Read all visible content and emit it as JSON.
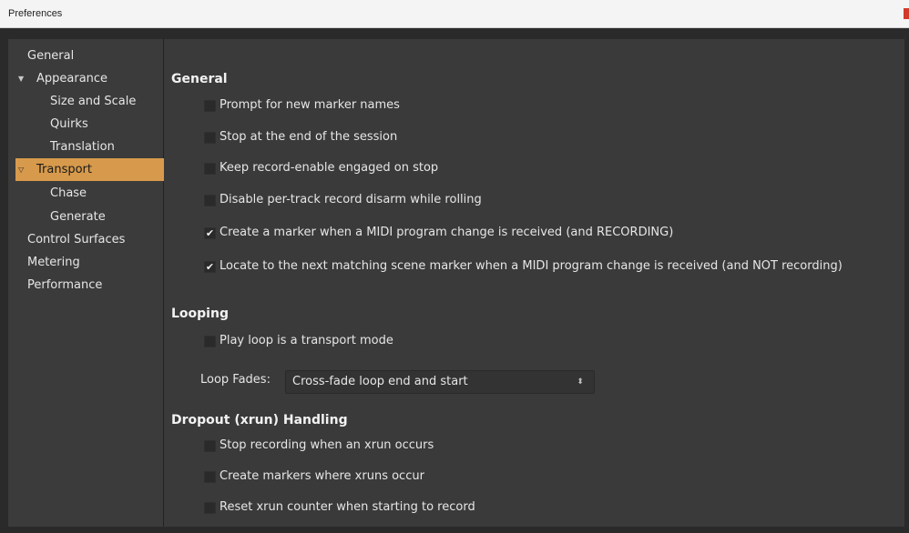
{
  "window": {
    "title": "Preferences"
  },
  "sidebar": {
    "items": [
      {
        "label": "General",
        "indent": 0,
        "arrow": "",
        "selected": false
      },
      {
        "label": "Appearance",
        "indent": 1,
        "arrow": "▼",
        "selected": false
      },
      {
        "label": "Size and Scale",
        "indent": 2,
        "arrow": "",
        "selected": false
      },
      {
        "label": "Quirks",
        "indent": 2,
        "arrow": "",
        "selected": false
      },
      {
        "label": "Translation",
        "indent": 2,
        "arrow": "",
        "selected": false
      },
      {
        "label": "Transport",
        "indent": 1,
        "arrow": "▽",
        "selected": true
      },
      {
        "label": "Chase",
        "indent": 2,
        "arrow": "",
        "selected": false
      },
      {
        "label": "Generate",
        "indent": 2,
        "arrow": "",
        "selected": false
      },
      {
        "label": "Control Surfaces",
        "indent": 0,
        "arrow": "",
        "selected": false
      },
      {
        "label": "Metering",
        "indent": 0,
        "arrow": "",
        "selected": false
      },
      {
        "label": "Performance",
        "indent": 0,
        "arrow": "",
        "selected": false
      }
    ]
  },
  "general": {
    "title": "General",
    "options": [
      {
        "label": "Prompt for new marker names",
        "checked": false
      },
      {
        "label": "Stop at the end of the session",
        "checked": false
      },
      {
        "label": "Keep record-enable engaged on stop",
        "checked": false
      },
      {
        "label": "Disable per-track record disarm while rolling",
        "checked": false
      },
      {
        "label": "Create a marker when a MIDI program change is received (and RECORDING)",
        "checked": true
      },
      {
        "label": "Locate to the next matching scene marker when a MIDI program change is received (and NOT recording)",
        "checked": true
      }
    ]
  },
  "looping": {
    "title": "Looping",
    "options": [
      {
        "label": "Play loop is a transport mode",
        "checked": false
      }
    ],
    "fades_label": "Loop Fades:",
    "fades_value": "Cross-fade loop end and start"
  },
  "dropout": {
    "title": "Dropout (xrun) Handling",
    "options": [
      {
        "label": "Stop recording when an xrun occurs",
        "checked": false
      },
      {
        "label": "Create markers where xruns occur",
        "checked": false
      },
      {
        "label": "Reset xrun counter when starting to record",
        "checked": false
      }
    ]
  },
  "icons": {
    "checkmark": "✔",
    "spinner": "⬍"
  }
}
